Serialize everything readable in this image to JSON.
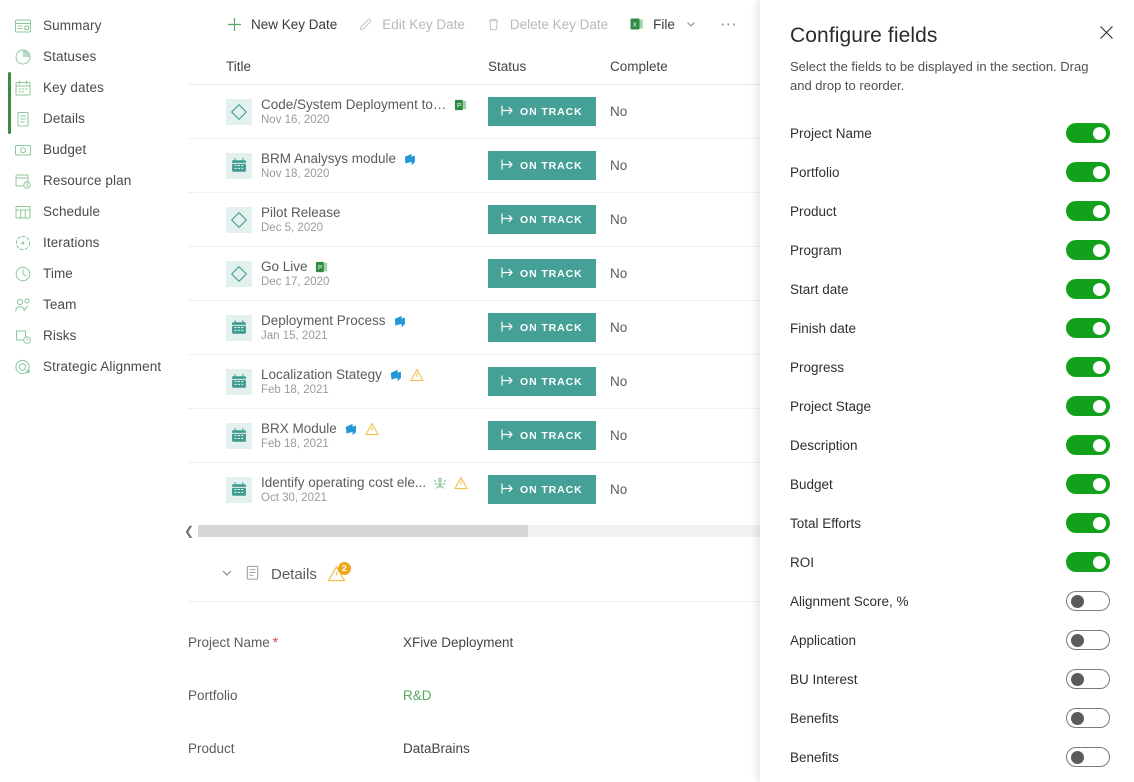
{
  "sidebar": {
    "items": [
      {
        "label": "Summary",
        "icon": "summary-icon",
        "selected": false
      },
      {
        "label": "Statuses",
        "icon": "statuses-icon",
        "selected": false
      },
      {
        "label": "Key dates",
        "icon": "calendar-icon",
        "selected": true
      },
      {
        "label": "Details",
        "icon": "clipboard-icon",
        "selected": true
      },
      {
        "label": "Budget",
        "icon": "money-icon",
        "selected": false
      },
      {
        "label": "Resource plan",
        "icon": "resource-plan-icon",
        "selected": false
      },
      {
        "label": "Schedule",
        "icon": "schedule-grid-icon",
        "selected": false
      },
      {
        "label": "Iterations",
        "icon": "iterations-icon",
        "selected": false
      },
      {
        "label": "Time",
        "icon": "clock-icon",
        "selected": false
      },
      {
        "label": "Team",
        "icon": "team-icon",
        "selected": false
      },
      {
        "label": "Risks",
        "icon": "risks-icon",
        "selected": false
      },
      {
        "label": "Strategic Alignment",
        "icon": "strategic-alignment-icon",
        "selected": false
      }
    ]
  },
  "toolbar": {
    "new_label": "New Key Date",
    "edit_label": "Edit Key Date",
    "delete_label": "Delete Key Date",
    "file_label": "File",
    "overflow_label": "⋯"
  },
  "table": {
    "columns": [
      "Title",
      "Status",
      "Complete"
    ],
    "rows": [
      {
        "type": "milestone",
        "title": "Code/System Deployment to Sta...",
        "date": "Nov 16, 2020",
        "marks": [
          "project-icon"
        ],
        "status": "ON TRACK",
        "complete": "No"
      },
      {
        "type": "task",
        "title": "BRM Analysys module",
        "date": "Nov 18, 2020",
        "marks": [
          "azure-devops-icon"
        ],
        "status": "ON TRACK",
        "complete": "No"
      },
      {
        "type": "milestone",
        "title": "Pilot Release",
        "date": "Dec 5, 2020",
        "marks": [],
        "status": "ON TRACK",
        "complete": "No"
      },
      {
        "type": "milestone",
        "title": "Go Live",
        "date": "Dec 17, 2020",
        "marks": [
          "project-icon"
        ],
        "status": "ON TRACK",
        "complete": "No"
      },
      {
        "type": "task",
        "title": "Deployment Process",
        "date": "Jan 15, 2021",
        "marks": [
          "azure-devops-icon"
        ],
        "status": "ON TRACK",
        "complete": "No"
      },
      {
        "type": "task",
        "title": "Localization Stategy",
        "date": "Feb 18, 2021",
        "marks": [
          "azure-devops-icon",
          "warning-icon"
        ],
        "status": "ON TRACK",
        "complete": "No"
      },
      {
        "type": "task",
        "title": "BRX Module",
        "date": "Feb 18, 2021",
        "marks": [
          "azure-devops-icon",
          "warning-icon"
        ],
        "status": "ON TRACK",
        "complete": "No"
      },
      {
        "type": "task",
        "title": "Identify operating cost ele...",
        "date": "Oct 30, 2021",
        "marks": [
          "people-icon",
          "warning-icon"
        ],
        "status": "ON TRACK",
        "complete": "No"
      }
    ]
  },
  "details": {
    "section_title": "Details",
    "warning_count": "2",
    "fields": [
      {
        "label": "Project Name",
        "required": true,
        "value": "XFive Deployment",
        "link": false
      },
      {
        "label": "Portfolio",
        "required": false,
        "value": "R&D",
        "link": true
      },
      {
        "label": "Product",
        "required": false,
        "value": "DataBrains",
        "link": false
      }
    ]
  },
  "panel": {
    "title": "Configure fields",
    "subtitle": "Select the fields to be displayed in the section. Drag and drop to reorder.",
    "close_label": "✕",
    "fields": [
      {
        "label": "Project Name",
        "on": true
      },
      {
        "label": "Portfolio",
        "on": true
      },
      {
        "label": "Product",
        "on": true
      },
      {
        "label": "Program",
        "on": true
      },
      {
        "label": "Start date",
        "on": true
      },
      {
        "label": "Finish date",
        "on": true
      },
      {
        "label": "Progress",
        "on": true
      },
      {
        "label": "Project Stage",
        "on": true
      },
      {
        "label": "Description",
        "on": true
      },
      {
        "label": "Budget",
        "on": true
      },
      {
        "label": "Total Efforts",
        "on": true
      },
      {
        "label": "ROI",
        "on": true
      },
      {
        "label": "Alignment Score, %",
        "on": false
      },
      {
        "label": "Application",
        "on": false
      },
      {
        "label": "BU Interest",
        "on": false
      },
      {
        "label": "Benefits",
        "on": false
      },
      {
        "label": "Benefits",
        "on": false
      }
    ]
  },
  "colors": {
    "accent_green": "#3d8b40",
    "icon_green": "#8cc79a",
    "status_teal": "#45a196",
    "toggle_on": "#11a11a",
    "warning_amber": "#f2c14e",
    "badge_orange": "#f2a71b",
    "link_green": "#5aa85f",
    "required_red": "#d83b3b"
  }
}
